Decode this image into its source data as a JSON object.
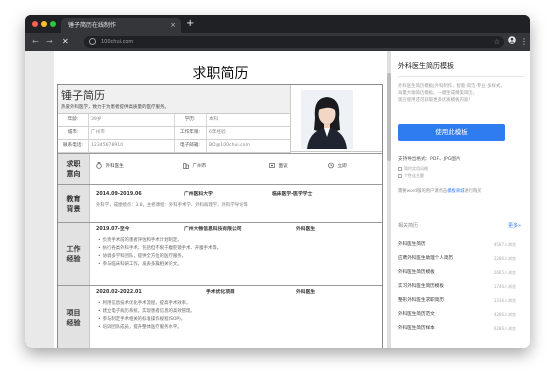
{
  "browser": {
    "tab_title": "锤子简历在线制作",
    "tab_close": "×",
    "new_tab": "+",
    "url": "100chui.com",
    "back_icon": "←",
    "forward_icon": "→",
    "stop_icon": "✕",
    "star_icon": "☆",
    "more_icon": "⋮"
  },
  "resume": {
    "title": "求职简历",
    "name": "锤子简历",
    "tagline": "热爱外科医学，致力于为患者提供高质量的医疗服务。",
    "info_rows": [
      {
        "label1": "年龄:",
        "value1": "39岁",
        "label2": "学历:",
        "value2": "本科"
      },
      {
        "label1": "城市:",
        "value1": "广州市",
        "label2": "工作年限:",
        "value2": "6年经验"
      },
      {
        "label1": "联系电话:",
        "value1": "12345678910",
        "label2": "电子邮箱:",
        "value2": "BD@100chui.com"
      }
    ],
    "intent": {
      "label": "求职意向",
      "items": [
        "外科医生",
        "广州市",
        "面议",
        "立即"
      ]
    },
    "education": {
      "label": "教育背景",
      "period": "2014.09-2019.06",
      "school": "广州医科大学",
      "major": "临床医学-医学学士",
      "detail": "外科学，成绩绩点：3.8，主修课程：外科手术学、外科病理学、外科学导论等"
    },
    "work": {
      "label": "工作经验",
      "period": "2019.07-至今",
      "company": "广州大畅信息科技有限公司",
      "position": "外科医生",
      "bullets": [
        "负责手术前的患者评估和手术计划制定。",
        "执行各类外科手术，包括但不限于腹腔镜手术、开腹手术等。",
        "协调多学科团队，提供全方位的医疗服务。",
        "参与临床科研工作，发表多篇相关论文。"
      ]
    },
    "project": {
      "label": "项目经验",
      "period": "2020.02-2022.01",
      "name": "手术优化项目",
      "role": "外科医生",
      "bullets": [
        "利用信息技术优化手术流程，提高手术效率。",
        "建立电子病历系统，实现患者信息的高效管理。",
        "参与制定手术相关的标准操作规程(SOP)。",
        "培训团队成员，提升整体医疗服务水平。"
      ]
    }
  },
  "sidebar": {
    "title": "外科医生简历模板",
    "desc_lines": [
      "外科医生简历模板|外科制作，智能·简洁·专业·多样式，",
      "海量大咖简历模板。一键生成精美简历，",
      "现在使用还可获取更多优质模板内容！"
    ],
    "use_button": "使用此模板",
    "formats": "支持导出格式：PDF、JPG图片",
    "checks": [
      "简约实用风格",
      "个性化主题"
    ],
    "help_prefix": "需要word版的用户请点击",
    "help_link": "模板商城",
    "help_suffix": "进行购买",
    "related_header": "相关简历",
    "related_more": "更多»",
    "related": [
      {
        "title": "外科医生简历",
        "count": "4587人浏览"
      },
      {
        "title": "应聘外科医生助理个人简历",
        "count": "2286人浏览"
      },
      {
        "title": "外科医生简历模板",
        "count": "2665人浏览"
      },
      {
        "title": "实习外科医生简历模板",
        "count": "1746人浏览"
      },
      {
        "title": "整形外科医生求职简历",
        "count": "1336人浏览"
      },
      {
        "title": "外科医生简历范文",
        "count": "4286人浏览"
      },
      {
        "title": "外科医生简历样本",
        "count": "6286人浏览"
      }
    ]
  }
}
